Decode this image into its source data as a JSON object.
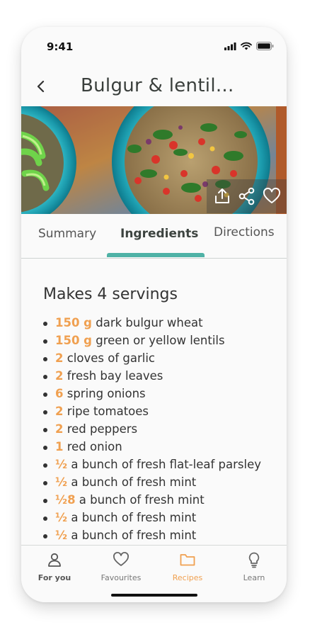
{
  "status_bar": {
    "time": "9:41"
  },
  "header": {
    "title": "Bulgur & lentil..."
  },
  "tabs": [
    {
      "label": "Summary",
      "active": false
    },
    {
      "label": "Ingredients",
      "active": true
    },
    {
      "label": "Directions",
      "active": false
    }
  ],
  "content": {
    "servings": "Makes 4 servings",
    "ingredients": [
      {
        "qty": "150 g",
        "text": " dark bulgur wheat"
      },
      {
        "qty": "150 g",
        "text": " green or yellow lentils"
      },
      {
        "qty": "2",
        "text": " cloves of garlic"
      },
      {
        "qty": "2",
        "text": " fresh bay leaves"
      },
      {
        "qty": "6",
        "text": " spring onions"
      },
      {
        "qty": "2",
        "text": " ripe tomatoes"
      },
      {
        "qty": "2",
        "text": " red peppers"
      },
      {
        "qty": "1",
        "text": " red onion"
      },
      {
        "qty": "½",
        "text": " a bunch of fresh flat-leaf parsley"
      },
      {
        "qty": "½",
        "text": " a bunch of fresh mint"
      },
      {
        "qty": "½8",
        "text": " a bunch of fresh mint"
      },
      {
        "qty": "½",
        "text": " a bunch of fresh mint"
      },
      {
        "qty": "½",
        "text": " a bunch of fresh mint"
      }
    ]
  },
  "bottom_nav": [
    {
      "label": "For you",
      "icon": "user-icon"
    },
    {
      "label": "Favourites",
      "icon": "heart-icon"
    },
    {
      "label": "Recipes",
      "icon": "folder-icon"
    },
    {
      "label": "Learn",
      "icon": "lightbulb-icon"
    }
  ],
  "colors": {
    "accent": "#4fb2a6",
    "quantity": "#f0a050",
    "active_nav": "#f0a050"
  }
}
